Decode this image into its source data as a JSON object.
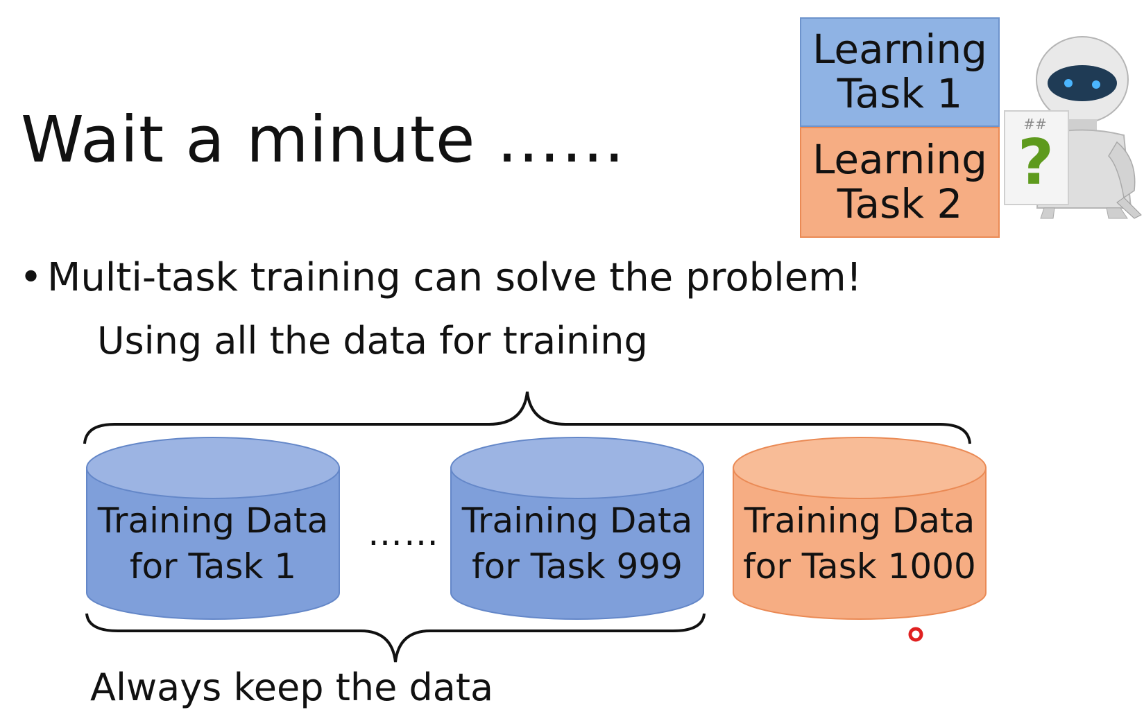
{
  "slide": {
    "title": "Wait a minute ……",
    "bullet": "Multi-task training can solve the problem!",
    "top_caption": "Using all the data for training",
    "bottom_caption": "Always keep the data",
    "ellipsis": "……"
  },
  "tasks": [
    {
      "line1": "Learning",
      "line2": "Task 1",
      "color": "#8fb3e4"
    },
    {
      "line1": "Learning",
      "line2": "Task 2",
      "color": "#f6ad83"
    }
  ],
  "robot": {
    "icon": "robot-icon",
    "sign": "?",
    "sign_small": "##"
  },
  "cylinders": [
    {
      "line1": "Training Data",
      "line2": "for Task 1",
      "color": "#7f9fda"
    },
    {
      "line1": "Training Data",
      "line2": "for Task 999",
      "color": "#7f9fda"
    },
    {
      "line1": "Training Data",
      "line2": "for Task 1000",
      "color": "#f6ad83"
    }
  ],
  "colors": {
    "blue_fill": "#7f9fda",
    "blue_top": "#9cb4e3",
    "orange_fill": "#f6ad83",
    "orange_top": "#f8bc97",
    "brace": "#111111",
    "cursor": "#e02020"
  }
}
